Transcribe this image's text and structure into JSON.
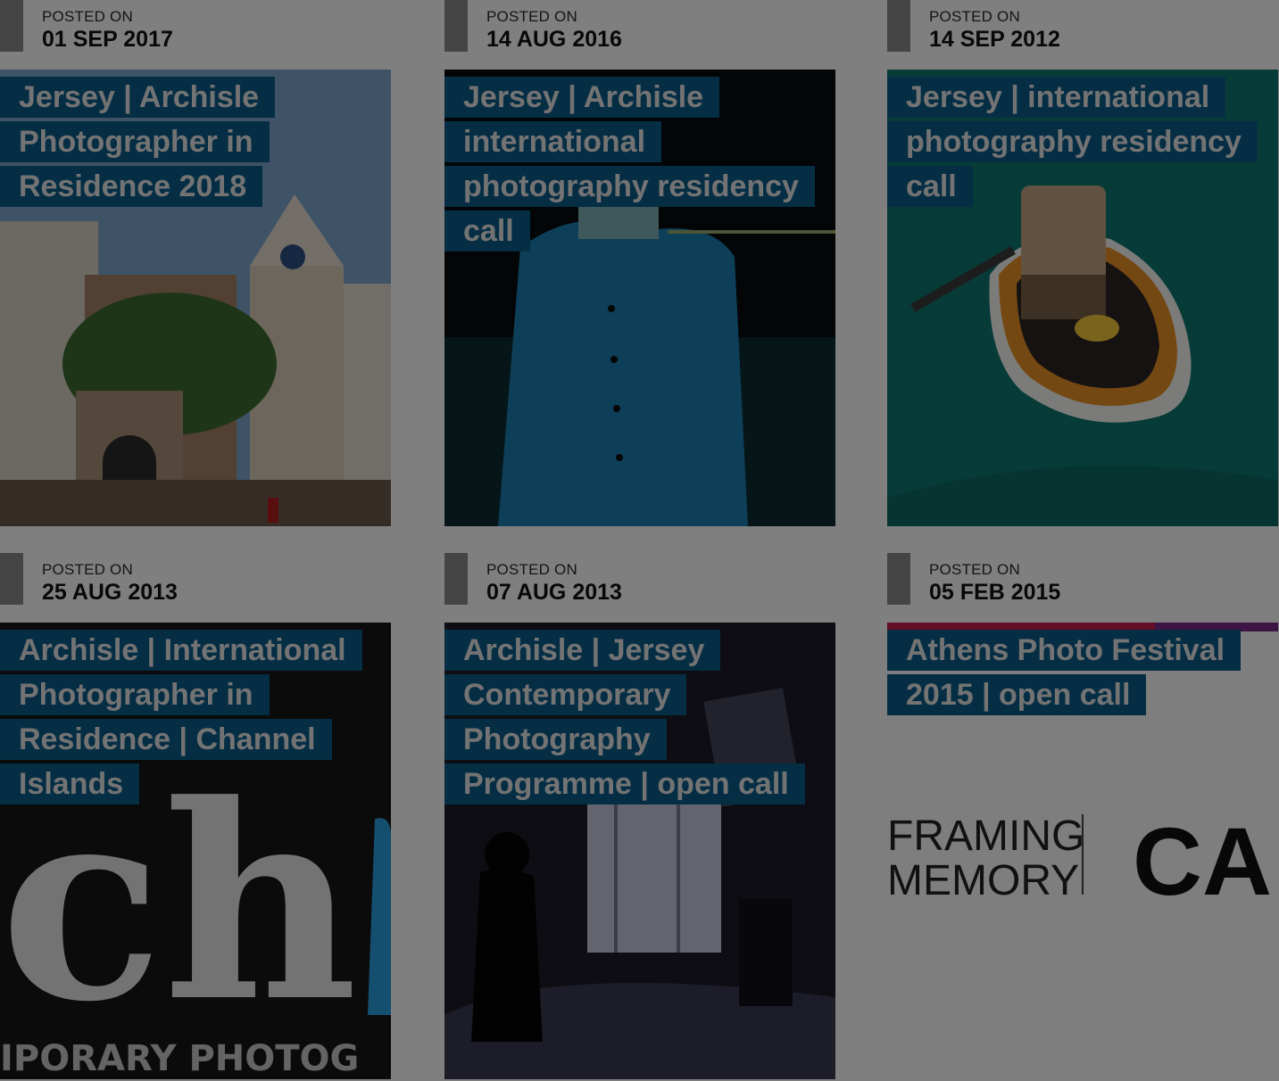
{
  "posts": [
    {
      "posted_label": "POSTED ON",
      "date": "01 SEP 2017",
      "title": "Jersey | Archisle Photographer in Residence 2018",
      "image": "jersey-museum-building"
    },
    {
      "posted_label": "POSTED ON",
      "date": "14 AUG 2016",
      "title": "Jersey | Archisle international photography residency call",
      "image": "man-blue-jacket-night"
    },
    {
      "posted_label": "POSTED ON",
      "date": "14 SEP 2012",
      "title": "Jersey | international photography residency call",
      "image": "man-rowing-orange-dinghy"
    },
    {
      "posted_label": "POSTED ON",
      "date": "25 AUG 2013",
      "title": "Archisle | International Photographer in Residence | Channel Islands",
      "image": "archisle-logo-closeup",
      "image_text": "IPORARY PHOTOG"
    },
    {
      "posted_label": "POSTED ON",
      "date": "07 AUG 2013",
      "title": "Archisle | Jersey Contemporary Photography Programme | open call",
      "image": "child-silhouette-interior"
    },
    {
      "posted_label": "POSTED ON",
      "date": "05 FEB 2015",
      "title": "Athens Photo Festival 2015 | open call",
      "image": "framing-memory-banner",
      "image_text_1": "FRAMING",
      "image_text_2": "MEMORY",
      "image_text_3": "CALI"
    }
  ],
  "colors": {
    "title_bg": "#0b5d8a",
    "overlay": "rgba(0,0,0,0.5)"
  }
}
